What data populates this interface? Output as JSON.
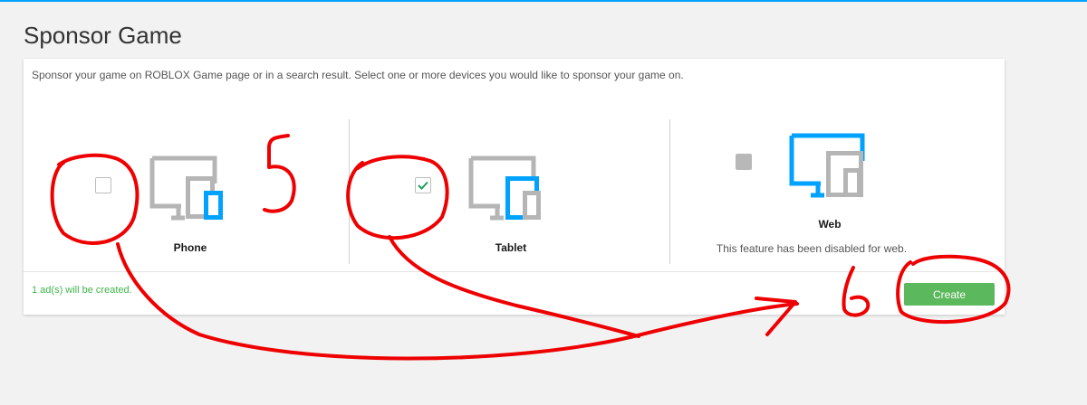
{
  "page": {
    "title": "Sponsor Game"
  },
  "card": {
    "description": "Sponsor your game on ROBLOX Game page or in a search result. Select one or more devices you would like to sponsor your game on.",
    "devices": [
      {
        "label": "Phone",
        "checked": false,
        "disabled": false,
        "icon": "phone-device-icon"
      },
      {
        "label": "Tablet",
        "checked": true,
        "disabled": false,
        "icon": "tablet-device-icon"
      },
      {
        "label": "Web",
        "checked": false,
        "disabled": true,
        "icon": "web-device-icon",
        "note": "This feature has been disabled for web."
      }
    ],
    "footer_text": "1 ad(s) will be created.",
    "create_label": "Create"
  },
  "colors": {
    "accent": "#00a2ff",
    "device_gray": "#b5b5b5",
    "success_green": "#5cb85c",
    "annotation_red": "#ee0000"
  }
}
